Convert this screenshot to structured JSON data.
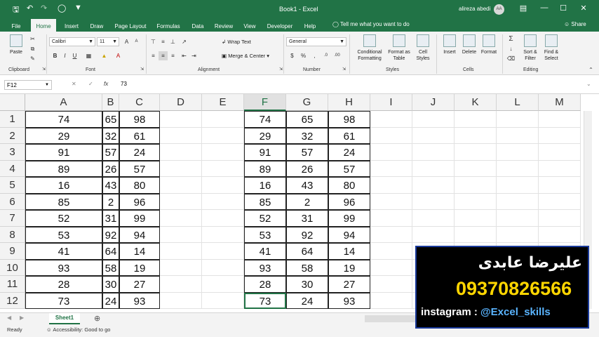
{
  "window": {
    "title": "Book1  -  Excel",
    "user": "alireza abedi",
    "avatar": "AA"
  },
  "tabs": [
    "File",
    "Home",
    "Insert",
    "Draw",
    "Page Layout",
    "Formulas",
    "Data",
    "Review",
    "View",
    "Developer",
    "Help"
  ],
  "tell_me": "Tell me what you want to do",
  "share": "Share",
  "ribbon": {
    "clipboard": {
      "paste": "Paste",
      "label": "Clipboard"
    },
    "font": {
      "name": "Calibri",
      "size": "11",
      "label": "Font"
    },
    "alignment": {
      "wrap": "Wrap Text",
      "merge": "Merge & Center",
      "label": "Alignment"
    },
    "number": {
      "format": "General",
      "label": "Number"
    },
    "styles": {
      "cond": "Conditional Formatting",
      "table": "Format as Table",
      "cell": "Cell Styles",
      "label": "Styles"
    },
    "cells": {
      "insert": "Insert",
      "delete": "Delete",
      "format": "Format",
      "label": "Cells"
    },
    "editing": {
      "sort": "Sort & Filter",
      "find": "Find & Select",
      "label": "Editing"
    }
  },
  "formula_bar": {
    "name_box": "F12",
    "fx": "fx",
    "value": "73"
  },
  "columns": [
    "A",
    "B",
    "C",
    "D",
    "E",
    "F",
    "G",
    "H",
    "I",
    "J",
    "K",
    "L",
    "M"
  ],
  "rows": [
    "1",
    "2",
    "3",
    "4",
    "5",
    "6",
    "7",
    "8",
    "9",
    "10",
    "11",
    "12"
  ],
  "table1": [
    [
      "74",
      "65",
      "98"
    ],
    [
      "29",
      "32",
      "61"
    ],
    [
      "91",
      "57",
      "24"
    ],
    [
      "89",
      "26",
      "57"
    ],
    [
      "16",
      "43",
      "80"
    ],
    [
      "85",
      "2",
      "96"
    ],
    [
      "52",
      "31",
      "99"
    ],
    [
      "53",
      "92",
      "94"
    ],
    [
      "41",
      "64",
      "14"
    ],
    [
      "93",
      "58",
      "19"
    ],
    [
      "28",
      "30",
      "27"
    ],
    [
      "73",
      "24",
      "93"
    ]
  ],
  "table2": [
    [
      "74",
      "65",
      "98"
    ],
    [
      "29",
      "32",
      "61"
    ],
    [
      "91",
      "57",
      "24"
    ],
    [
      "89",
      "26",
      "57"
    ],
    [
      "16",
      "43",
      "80"
    ],
    [
      "85",
      "2",
      "96"
    ],
    [
      "52",
      "31",
      "99"
    ],
    [
      "53",
      "92",
      "94"
    ],
    [
      "41",
      "64",
      "14"
    ],
    [
      "93",
      "58",
      "19"
    ],
    [
      "28",
      "30",
      "27"
    ],
    [
      "73",
      "24",
      "93"
    ]
  ],
  "sheet_tab": "Sheet1",
  "status": {
    "ready": "Ready",
    "accessibility": "Accessibility: Good to go"
  },
  "overlay": {
    "name": "علیرضا عابدی",
    "phone": "09370826566",
    "insta_label": "instagram : ",
    "insta_handle": "@Excel_skills"
  },
  "colors": {
    "accent": "#217346",
    "phone": "#ffd600",
    "handle": "#5ab4ff"
  }
}
